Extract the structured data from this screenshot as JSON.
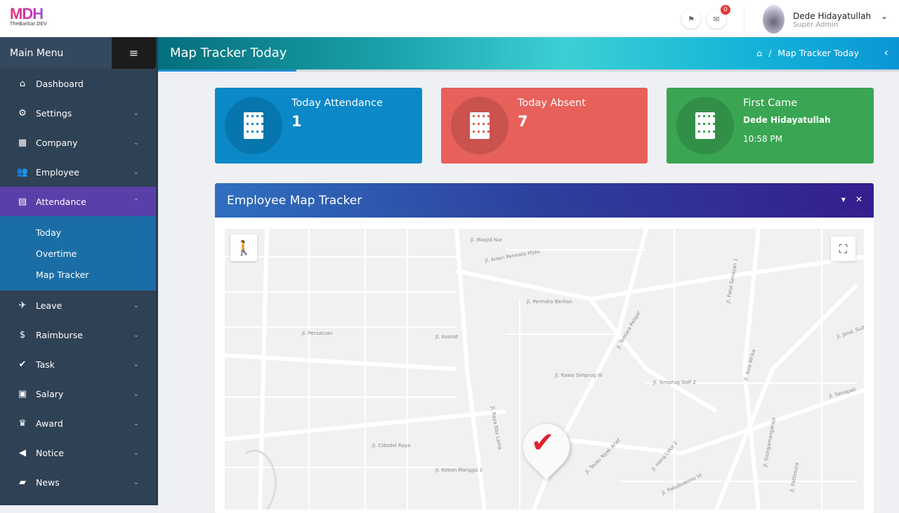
{
  "header": {
    "logo_main": "MDH",
    "logo_sub": "TheBarbar.DEV",
    "message_count": "0",
    "user_name": "Dede Hidayatullah",
    "user_role": "Super Admin"
  },
  "sidebar": {
    "title": "Main Menu",
    "items": [
      {
        "label": "Dashboard",
        "icon": "home-icon",
        "glyph": "⌂",
        "chev": ""
      },
      {
        "label": "Settings",
        "icon": "gears-icon",
        "glyph": "⚙",
        "chev": "⌄"
      },
      {
        "label": "Company",
        "icon": "building-icon",
        "glyph": "▦",
        "chev": "⌄"
      },
      {
        "label": "Employee",
        "icon": "users-icon",
        "glyph": "👥",
        "chev": "⌄"
      },
      {
        "label": "Attendance",
        "icon": "calendar-icon",
        "glyph": "▤",
        "chev": "⌃"
      }
    ],
    "sub_items": [
      "Today",
      "Overtime",
      "Map Tracker"
    ],
    "items2": [
      {
        "label": "Leave",
        "icon": "plane-icon",
        "glyph": "✈",
        "chev": "⌄"
      },
      {
        "label": "Raimburse",
        "icon": "dollar-icon",
        "glyph": "$",
        "chev": "⌄"
      },
      {
        "label": "Task",
        "icon": "check-icon",
        "glyph": "✔",
        "chev": "⌄"
      },
      {
        "label": "Salary",
        "icon": "money-icon",
        "glyph": "▣",
        "chev": "⌄"
      },
      {
        "label": "Award",
        "icon": "trophy-icon",
        "glyph": "♛",
        "chev": "⌄"
      },
      {
        "label": "Notice",
        "icon": "volume-icon",
        "glyph": "◀",
        "chev": "⌄"
      },
      {
        "label": "News",
        "icon": "book-icon",
        "glyph": "▰",
        "chev": "⌄"
      }
    ]
  },
  "page": {
    "title": "Map Tracker Today",
    "breadcrumb": "Map Tracker Today"
  },
  "cards": {
    "attendance_label": "Today Attendance",
    "attendance_value": "1",
    "absent_label": "Today Absent",
    "absent_value": "7",
    "first_label": "First Came",
    "first_name": "Dede Hidayatullah",
    "first_time": "10:58 PM",
    "colors": {
      "attendance": "#0a88c8",
      "absent": "#e8605a",
      "first": "#3aa552"
    }
  },
  "panel": {
    "title": "Employee Map Tracker"
  },
  "map": {
    "streets": [
      "Jl. Arteri Permata Hijau",
      "Jl. Permata Berlian",
      "Jl. Tentara Pelajar",
      "Jl. Patal Senayan 1",
      "Jl. Raya Kby Lama",
      "Jl. Teuku Nyak Arief",
      "Jl. Senopati",
      "Jl. Jend. Sudirman",
      "Jl. Hang Lekir 2",
      "Jl. Pakubuwono VI",
      "Jl. Sisingamangaraja",
      "Jl. Asia Afrika",
      "Jl. Cidodol Raya",
      "Jl. Simprug Golf 2",
      "Jl. Kebon Mangga 1",
      "Jl. Pattimura",
      "Jl. Rawa Simprug III",
      "Jl. Persatuan",
      "Jl. Assirot",
      "Jl. Masjid Nur"
    ]
  }
}
